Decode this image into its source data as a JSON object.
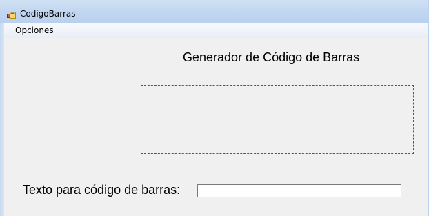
{
  "window": {
    "title": "CodigoBarras",
    "icon": "windows-form-icon"
  },
  "menu": {
    "items": [
      {
        "label": "Opciones"
      }
    ]
  },
  "main": {
    "heading": "Generador de Código de Barras",
    "barcode_area": {
      "icon": "barcode-picture-box"
    },
    "input_label": "Texto para código de barras:",
    "input_value": "",
    "input_placeholder": ""
  },
  "colors": {
    "titlebar": "#c2d8f1",
    "window_bg": "#f0f0f0",
    "input_border": "#7a7a7a",
    "dashed_border": "#555555"
  }
}
